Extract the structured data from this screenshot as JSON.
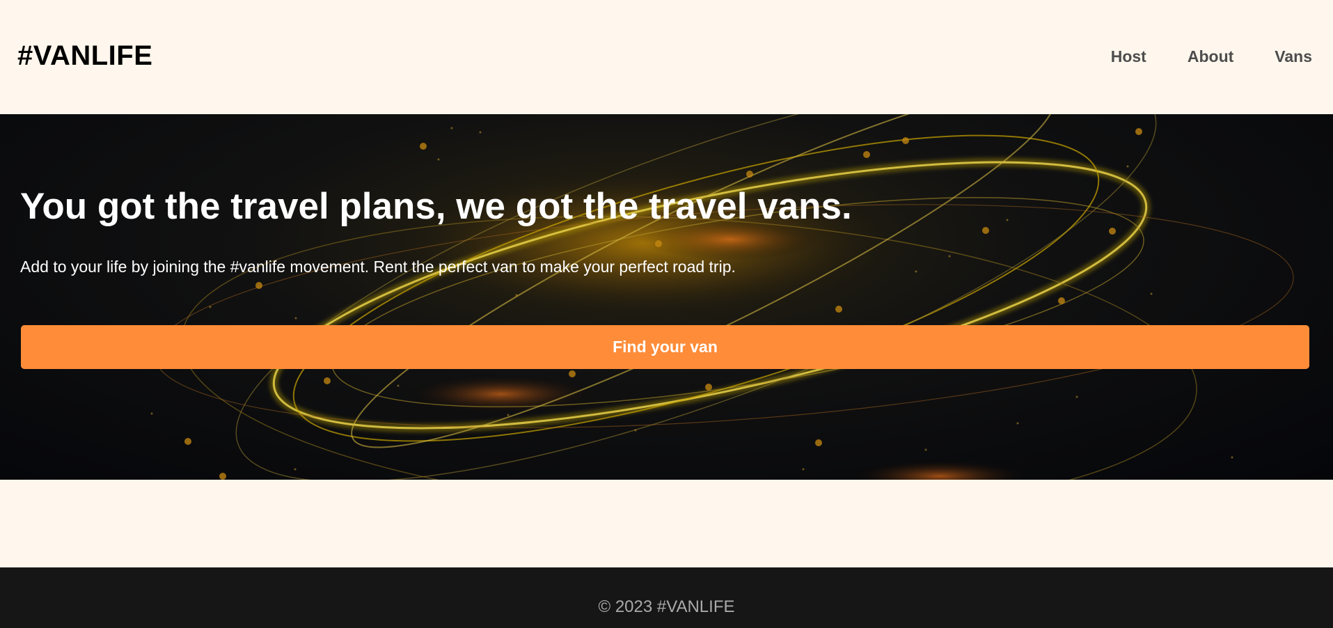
{
  "header": {
    "logo": "#VANLIFE",
    "nav": [
      {
        "label": "Host"
      },
      {
        "label": "About"
      },
      {
        "label": "Vans"
      }
    ]
  },
  "hero": {
    "title": "You got the travel plans, we got the travel vans.",
    "subtitle": "Add to your life by joining the #vanlife movement. Rent the perfect van to make your perfect road trip.",
    "cta_label": "Find your van"
  },
  "footer": {
    "copyright": "© 2023 #VANLIFE"
  },
  "colors": {
    "page_background": "#FFF7ED",
    "accent": "#FF8C38",
    "footer_background": "#161616",
    "hero_background": "#05060a"
  }
}
